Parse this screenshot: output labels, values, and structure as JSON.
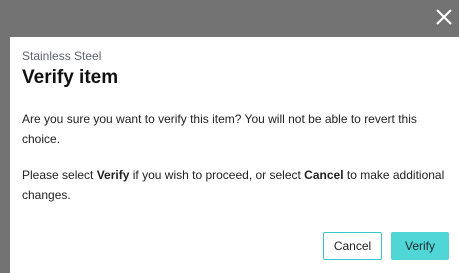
{
  "dialog": {
    "subtitle": "Stainless Steel",
    "title": "Verify item",
    "question": "Are you sure you want to verify this item? You will not be able to revert this choice.",
    "instruction_prefix": "Please select ",
    "instruction_verify": "Verify",
    "instruction_middle": " if you wish to proceed, or select ",
    "instruction_cancel": "Cancel",
    "instruction_suffix": " to make additional changes.",
    "cancel_label": "Cancel",
    "verify_label": "Verify"
  },
  "icons": {
    "close": "close-icon"
  },
  "colors": {
    "accent": "#4fd6d5",
    "accent_border": "#39c6c8",
    "overlay": "#737373"
  }
}
